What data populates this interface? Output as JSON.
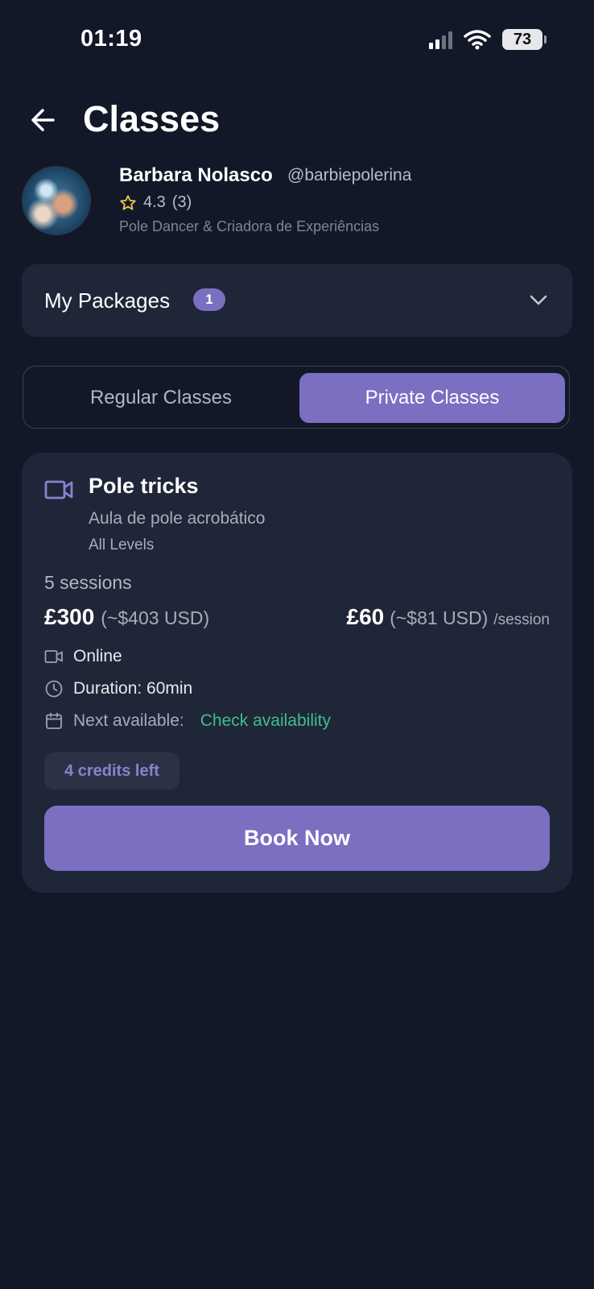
{
  "status_bar": {
    "time": "01:19",
    "battery": "73"
  },
  "header": {
    "title": "Classes"
  },
  "profile": {
    "name": "Barbara Nolasco",
    "handle": "@barbiepolerina",
    "rating": "4.3",
    "rating_count": "(3)",
    "bio": "Pole Dancer & Criadora de Experiências"
  },
  "packages": {
    "label": "My Packages",
    "count": "1"
  },
  "tabs": [
    {
      "label": "Regular Classes",
      "active": false
    },
    {
      "label": "Private Classes",
      "active": true
    }
  ],
  "class_card": {
    "title": "Pole tricks",
    "subtitle": "Aula de pole acrobático",
    "level": "All Levels",
    "sessions": "5 sessions",
    "price_total": "£300",
    "price_total_usd": "(~$403 USD)",
    "price_session": "£60",
    "price_session_usd": "(~$81 USD)",
    "per_session": "/session",
    "mode": "Online",
    "duration": "Duration: 60min",
    "next_label": "Next available:",
    "next_link": "Check availability",
    "credits": "4 credits left",
    "book_label": "Book Now"
  },
  "colors": {
    "background": "#121828",
    "card": "#1f2637",
    "accent": "#7b6fc2",
    "link_green": "#3fbf8d",
    "star": "#f5c542"
  },
  "icons": [
    "back-arrow-icon",
    "star-icon",
    "chevron-down-icon",
    "video-camera-icon",
    "clock-icon",
    "calendar-icon",
    "signal-icon",
    "wifi-icon",
    "battery-icon"
  ]
}
